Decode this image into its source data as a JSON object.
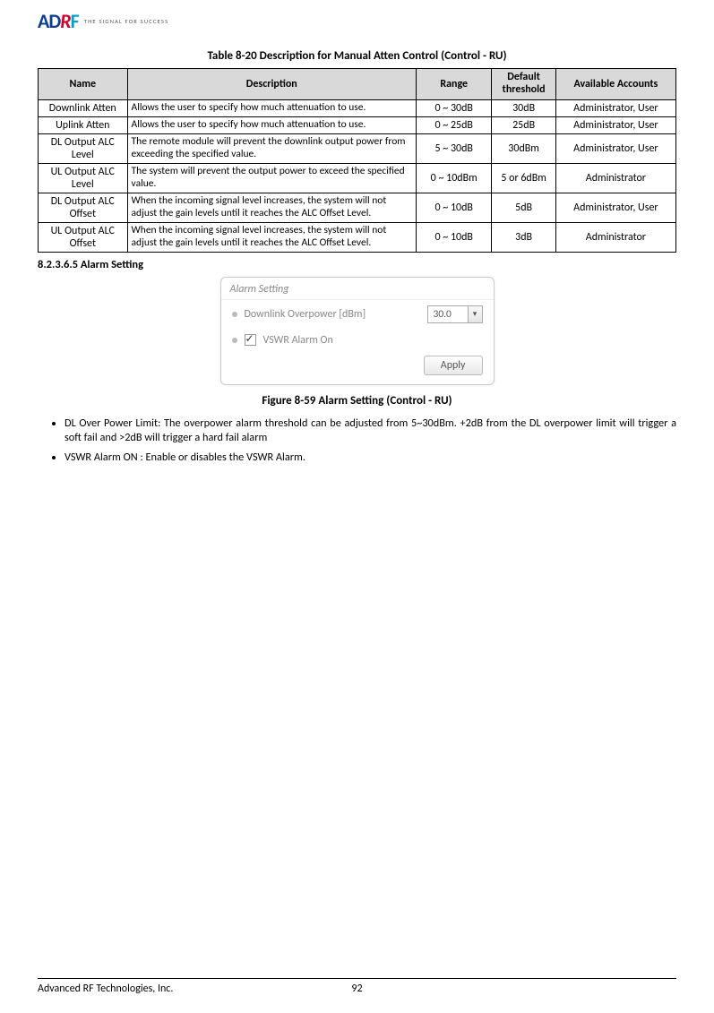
{
  "logo_tagline": "THE SIGNAL FOR SUCCESS",
  "table_caption": "Table 8-20    Description for Manual Atten Control (Control - RU)",
  "table_headers": {
    "name": "Name",
    "description": "Description",
    "range": "Range",
    "default": "Default threshold",
    "accounts": "Available Accounts"
  },
  "rows": [
    {
      "name": "Downlink Atten",
      "desc": "Allows the user to specify how much attenuation to use.",
      "range": "0 ~ 30dB",
      "def": "30dB",
      "acct": "Administrator, User"
    },
    {
      "name": "Uplink Atten",
      "desc": "Allows the user to specify how much attenuation to use.",
      "range": "0 ~ 25dB",
      "def": "25dB",
      "acct": "Administrator, User"
    },
    {
      "name": "DL Output ALC Level",
      "desc": "The remote module will prevent the downlink output power from exceeding the specified value.",
      "range": "5 ~ 30dB",
      "def": "30dBm",
      "acct": "Administrator, User"
    },
    {
      "name": "UL Output ALC Level",
      "desc": "The system will prevent the output power to exceed the specified value.",
      "range": "0 ~ 10dBm",
      "def": "5 or 6dBm",
      "acct": "Administrator"
    },
    {
      "name": "DL Output ALC Offset",
      "desc": "When the incoming signal level increases, the system will not adjust the gain levels until it reaches the ALC Offset Level.",
      "range": "0 ~ 10dB",
      "def": "5dB",
      "acct": "Administrator, User"
    },
    {
      "name": "UL Output ALC Offset",
      "desc": "When the incoming signal level increases, the system will not adjust the gain levels until it reaches the ALC Offset Level.",
      "range": "0 ~ 10dB",
      "def": "3dB",
      "acct": "Administrator"
    }
  ],
  "section_header": "8.2.3.6.5    Alarm Setting",
  "alarm_widget": {
    "title": "Alarm Setting",
    "row1_label": "Downlink Overpower [dBm]",
    "row1_value": "30.0",
    "row2_label": "VSWR Alarm On",
    "apply_label": "Apply"
  },
  "figure_caption": "Figure 8-59   Alarm Setting (Control - RU)",
  "bullets": [
    "DL Over Power Limit: The overpower alarm threshold can be adjusted from 5~30dBm. +2dB from the DL overpower limit will trigger a soft fail and >2dB will trigger a hard fail alarm",
    "VSWR Alarm ON : Enable or disables the VSWR Alarm."
  ],
  "footer": {
    "left": "Advanced RF Technologies, Inc.",
    "center": "92"
  }
}
